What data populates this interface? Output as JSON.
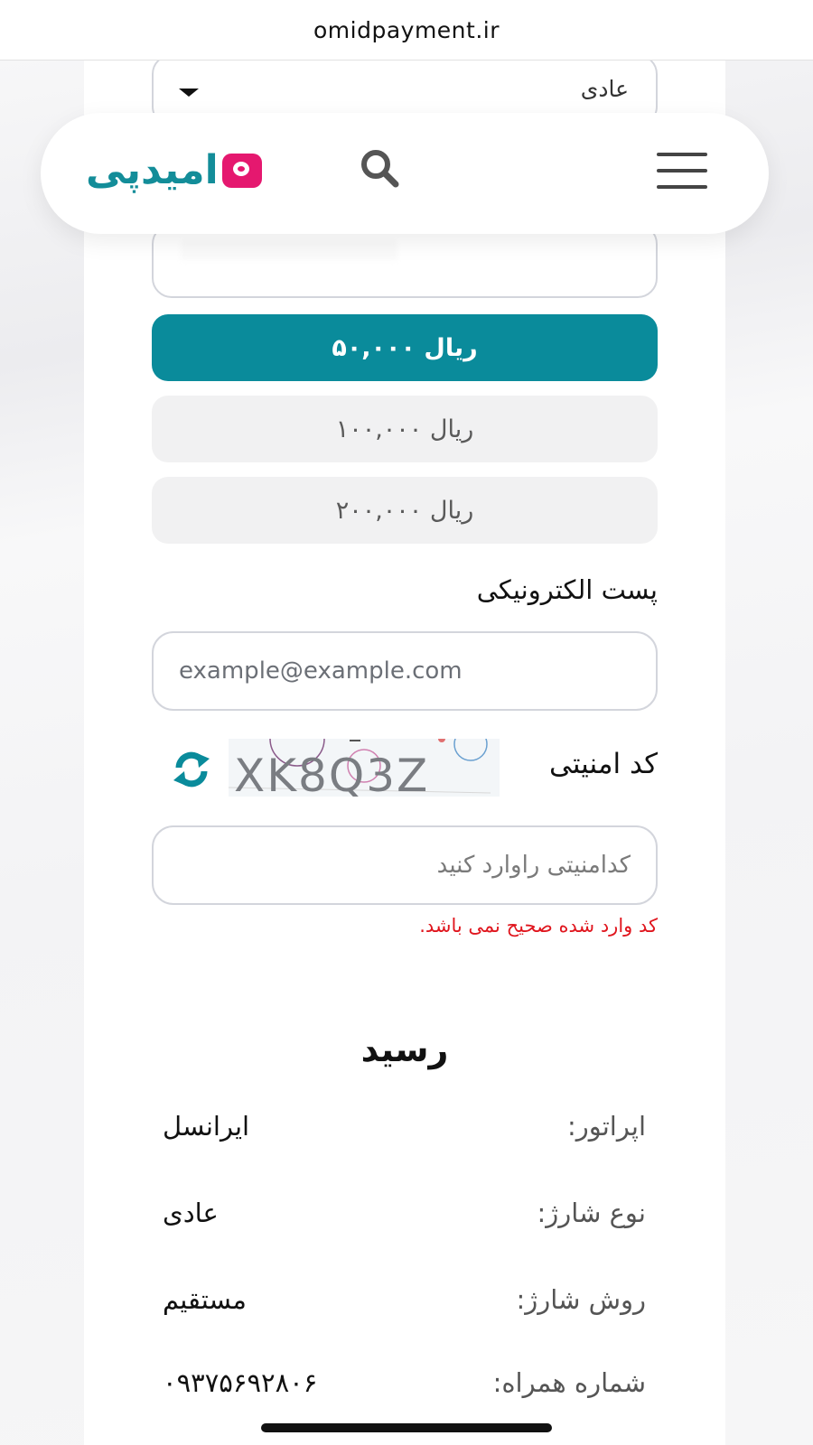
{
  "browser": {
    "url": "omidpayment.ir"
  },
  "header": {
    "logo_text": "امیدپی",
    "search_icon": "search-icon",
    "menu_icon": "hamburger-menu-icon"
  },
  "form": {
    "charge_type_select": {
      "value": "عادی"
    },
    "amounts": [
      {
        "label": "۵۰,۰۰۰ ریال",
        "selected": true
      },
      {
        "label": "۱۰۰,۰۰۰ ریال",
        "selected": false
      },
      {
        "label": "۲۰۰,۰۰۰ ریال",
        "selected": false
      }
    ],
    "email_label": "پست الکترونیکی",
    "email_placeholder": "example@example.com",
    "captcha_label": "کد امنیتی",
    "captcha_text": "XK8Q3Z",
    "captcha_placeholder": "کدامنیتی راوارد کنید",
    "captcha_error": "کد وارد شده صحیح نمی باشد."
  },
  "receipt": {
    "title": "رسید",
    "rows": [
      {
        "key": "اپراتور:",
        "value": "ایرانسل"
      },
      {
        "key": "نوع شارژ:",
        "value": "عادی"
      },
      {
        "key": "روش شارژ:",
        "value": "مستقیم"
      },
      {
        "key": "شماره همراه:",
        "value": "۰۹۳۷۵۶۹۲۸۰۶"
      }
    ]
  },
  "colors": {
    "accent": "#0a8b9b",
    "brand_pink": "#e5186f",
    "error": "#e0161e"
  }
}
